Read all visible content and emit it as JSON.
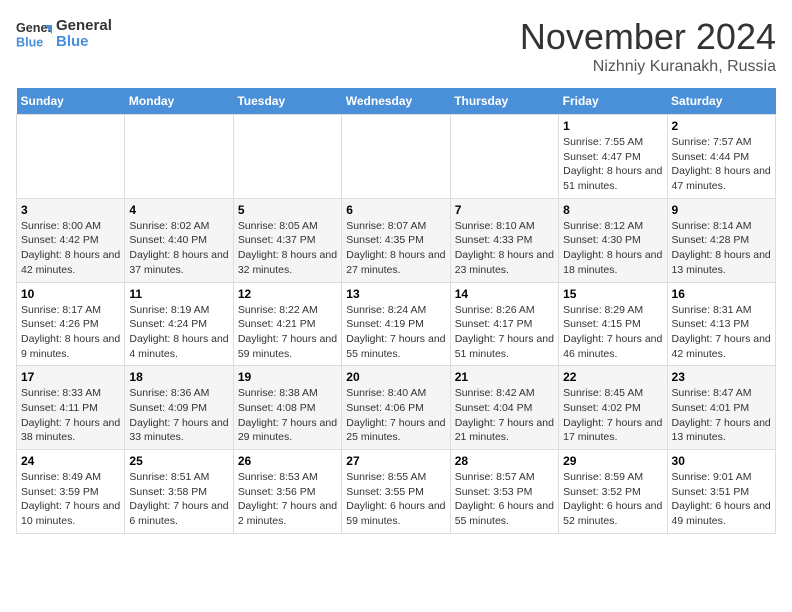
{
  "header": {
    "logo_line1": "General",
    "logo_line2": "Blue",
    "month_title": "November 2024",
    "subtitle": "Nizhniy Kuranakh, Russia"
  },
  "weekdays": [
    "Sunday",
    "Monday",
    "Tuesday",
    "Wednesday",
    "Thursday",
    "Friday",
    "Saturday"
  ],
  "weeks": [
    [
      {
        "day": "",
        "info": ""
      },
      {
        "day": "",
        "info": ""
      },
      {
        "day": "",
        "info": ""
      },
      {
        "day": "",
        "info": ""
      },
      {
        "day": "",
        "info": ""
      },
      {
        "day": "1",
        "info": "Sunrise: 7:55 AM\nSunset: 4:47 PM\nDaylight: 8 hours and 51 minutes."
      },
      {
        "day": "2",
        "info": "Sunrise: 7:57 AM\nSunset: 4:44 PM\nDaylight: 8 hours and 47 minutes."
      }
    ],
    [
      {
        "day": "3",
        "info": "Sunrise: 8:00 AM\nSunset: 4:42 PM\nDaylight: 8 hours and 42 minutes."
      },
      {
        "day": "4",
        "info": "Sunrise: 8:02 AM\nSunset: 4:40 PM\nDaylight: 8 hours and 37 minutes."
      },
      {
        "day": "5",
        "info": "Sunrise: 8:05 AM\nSunset: 4:37 PM\nDaylight: 8 hours and 32 minutes."
      },
      {
        "day": "6",
        "info": "Sunrise: 8:07 AM\nSunset: 4:35 PM\nDaylight: 8 hours and 27 minutes."
      },
      {
        "day": "7",
        "info": "Sunrise: 8:10 AM\nSunset: 4:33 PM\nDaylight: 8 hours and 23 minutes."
      },
      {
        "day": "8",
        "info": "Sunrise: 8:12 AM\nSunset: 4:30 PM\nDaylight: 8 hours and 18 minutes."
      },
      {
        "day": "9",
        "info": "Sunrise: 8:14 AM\nSunset: 4:28 PM\nDaylight: 8 hours and 13 minutes."
      }
    ],
    [
      {
        "day": "10",
        "info": "Sunrise: 8:17 AM\nSunset: 4:26 PM\nDaylight: 8 hours and 9 minutes."
      },
      {
        "day": "11",
        "info": "Sunrise: 8:19 AM\nSunset: 4:24 PM\nDaylight: 8 hours and 4 minutes."
      },
      {
        "day": "12",
        "info": "Sunrise: 8:22 AM\nSunset: 4:21 PM\nDaylight: 7 hours and 59 minutes."
      },
      {
        "day": "13",
        "info": "Sunrise: 8:24 AM\nSunset: 4:19 PM\nDaylight: 7 hours and 55 minutes."
      },
      {
        "day": "14",
        "info": "Sunrise: 8:26 AM\nSunset: 4:17 PM\nDaylight: 7 hours and 51 minutes."
      },
      {
        "day": "15",
        "info": "Sunrise: 8:29 AM\nSunset: 4:15 PM\nDaylight: 7 hours and 46 minutes."
      },
      {
        "day": "16",
        "info": "Sunrise: 8:31 AM\nSunset: 4:13 PM\nDaylight: 7 hours and 42 minutes."
      }
    ],
    [
      {
        "day": "17",
        "info": "Sunrise: 8:33 AM\nSunset: 4:11 PM\nDaylight: 7 hours and 38 minutes."
      },
      {
        "day": "18",
        "info": "Sunrise: 8:36 AM\nSunset: 4:09 PM\nDaylight: 7 hours and 33 minutes."
      },
      {
        "day": "19",
        "info": "Sunrise: 8:38 AM\nSunset: 4:08 PM\nDaylight: 7 hours and 29 minutes."
      },
      {
        "day": "20",
        "info": "Sunrise: 8:40 AM\nSunset: 4:06 PM\nDaylight: 7 hours and 25 minutes."
      },
      {
        "day": "21",
        "info": "Sunrise: 8:42 AM\nSunset: 4:04 PM\nDaylight: 7 hours and 21 minutes."
      },
      {
        "day": "22",
        "info": "Sunrise: 8:45 AM\nSunset: 4:02 PM\nDaylight: 7 hours and 17 minutes."
      },
      {
        "day": "23",
        "info": "Sunrise: 8:47 AM\nSunset: 4:01 PM\nDaylight: 7 hours and 13 minutes."
      }
    ],
    [
      {
        "day": "24",
        "info": "Sunrise: 8:49 AM\nSunset: 3:59 PM\nDaylight: 7 hours and 10 minutes."
      },
      {
        "day": "25",
        "info": "Sunrise: 8:51 AM\nSunset: 3:58 PM\nDaylight: 7 hours and 6 minutes."
      },
      {
        "day": "26",
        "info": "Sunrise: 8:53 AM\nSunset: 3:56 PM\nDaylight: 7 hours and 2 minutes."
      },
      {
        "day": "27",
        "info": "Sunrise: 8:55 AM\nSunset: 3:55 PM\nDaylight: 6 hours and 59 minutes."
      },
      {
        "day": "28",
        "info": "Sunrise: 8:57 AM\nSunset: 3:53 PM\nDaylight: 6 hours and 55 minutes."
      },
      {
        "day": "29",
        "info": "Sunrise: 8:59 AM\nSunset: 3:52 PM\nDaylight: 6 hours and 52 minutes."
      },
      {
        "day": "30",
        "info": "Sunrise: 9:01 AM\nSunset: 3:51 PM\nDaylight: 6 hours and 49 minutes."
      }
    ]
  ]
}
